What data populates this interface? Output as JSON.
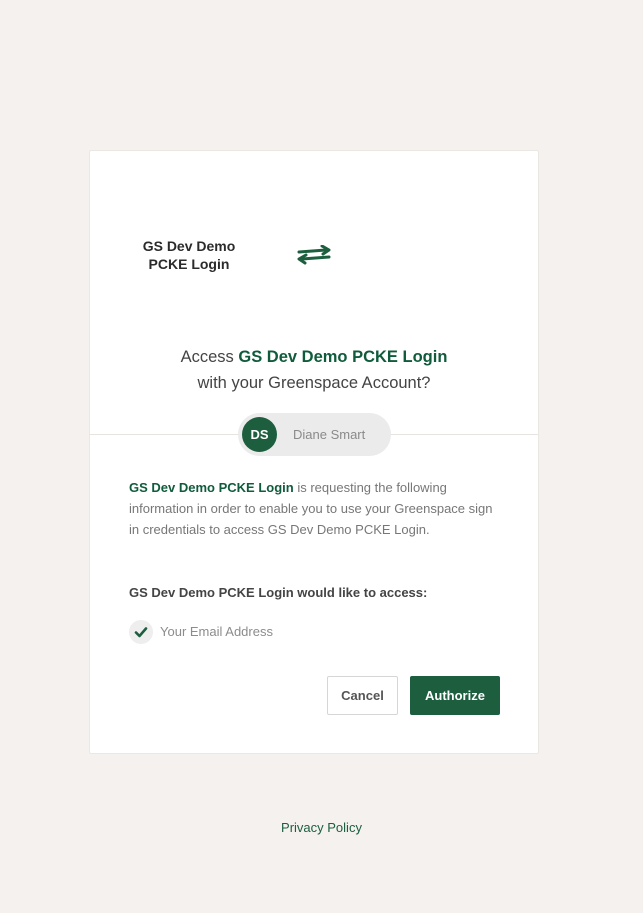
{
  "client": {
    "name": "GS Dev Demo PCKE Login"
  },
  "heading": {
    "prefix": "Access ",
    "app": "GS Dev Demo PCKE Login",
    "suffix": "with your Greenspace Account?"
  },
  "user": {
    "initials": "DS",
    "name": "Diane Smart"
  },
  "description": {
    "app": "GS Dev Demo PCKE Login",
    "text": " is requesting the following information in order to enable you to use your Greenspace sign in credentials to access GS Dev Demo PCKE Login."
  },
  "access": {
    "title": "GS Dev Demo PCKE Login would like to access:",
    "scopes": [
      {
        "label": "Your Email Address",
        "icon": "check-icon"
      }
    ]
  },
  "buttons": {
    "cancel": "Cancel",
    "authorize": "Authorize"
  },
  "footer": {
    "privacy": "Privacy Policy"
  },
  "colors": {
    "accent": "#1d5e3f",
    "background": "#f4f1ee"
  }
}
